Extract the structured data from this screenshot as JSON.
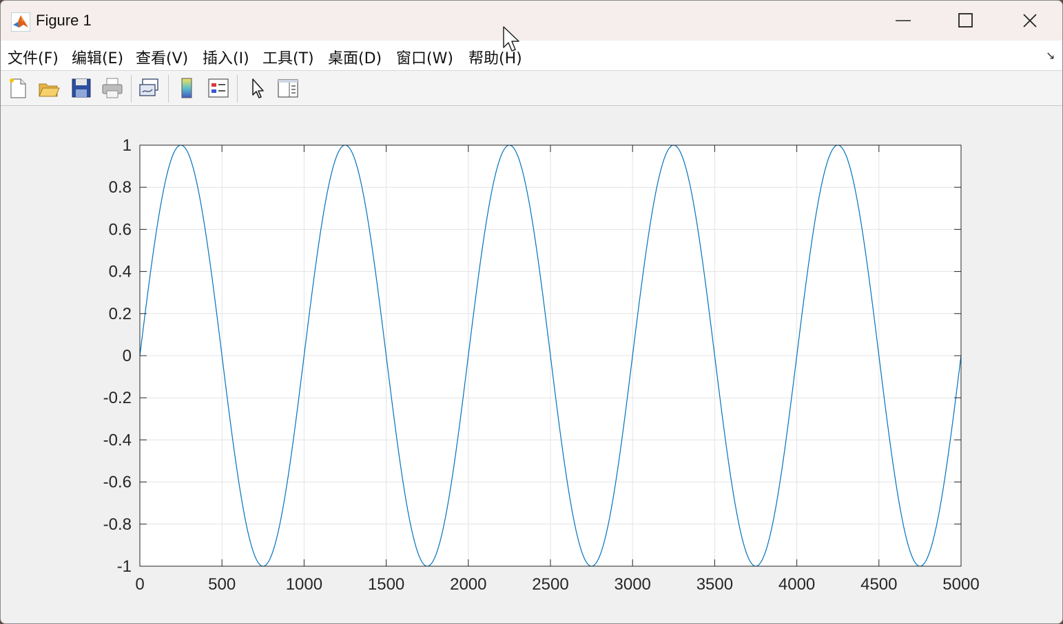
{
  "window": {
    "title": "Figure 1"
  },
  "menu": {
    "items": [
      {
        "label": "文件(F)"
      },
      {
        "label": "编辑(E)"
      },
      {
        "label": "查看(V)"
      },
      {
        "label": "插入(I)"
      },
      {
        "label": "工具(T)"
      },
      {
        "label": "桌面(D)"
      },
      {
        "label": "窗口(W)"
      },
      {
        "label": "帮助(H)"
      }
    ]
  },
  "toolbar": {
    "buttons": [
      {
        "icon": "new-figure-icon"
      },
      {
        "icon": "open-file-icon"
      },
      {
        "icon": "save-icon"
      },
      {
        "icon": "print-icon"
      },
      {
        "icon": "link-plot-icon"
      },
      {
        "icon": "colorbar-icon"
      },
      {
        "icon": "legend-icon"
      },
      {
        "icon": "edit-plot-arrow-icon"
      },
      {
        "icon": "property-inspector-icon"
      }
    ]
  },
  "chart_data": {
    "type": "line",
    "title": "",
    "xlabel": "",
    "ylabel": "",
    "xlim": [
      0,
      5000
    ],
    "ylim": [
      -1,
      1
    ],
    "xticks": [
      0,
      500,
      1000,
      1500,
      2000,
      2500,
      3000,
      3500,
      4000,
      4500,
      5000
    ],
    "yticks": [
      -1,
      -0.8,
      -0.6,
      -0.4,
      -0.2,
      0,
      0.2,
      0.4,
      0.6,
      0.8,
      1
    ],
    "ytick_labels": [
      "-1",
      "-0.8",
      "-0.6",
      "-0.4",
      "-0.2",
      "0",
      "0.2",
      "0.4",
      "0.6",
      "0.8",
      "1"
    ],
    "grid": true,
    "series": [
      {
        "function": "sin",
        "period": 1000,
        "amplitude": 1,
        "x_start": 0,
        "x_end": 5000,
        "color": "#0072BD"
      }
    ]
  }
}
